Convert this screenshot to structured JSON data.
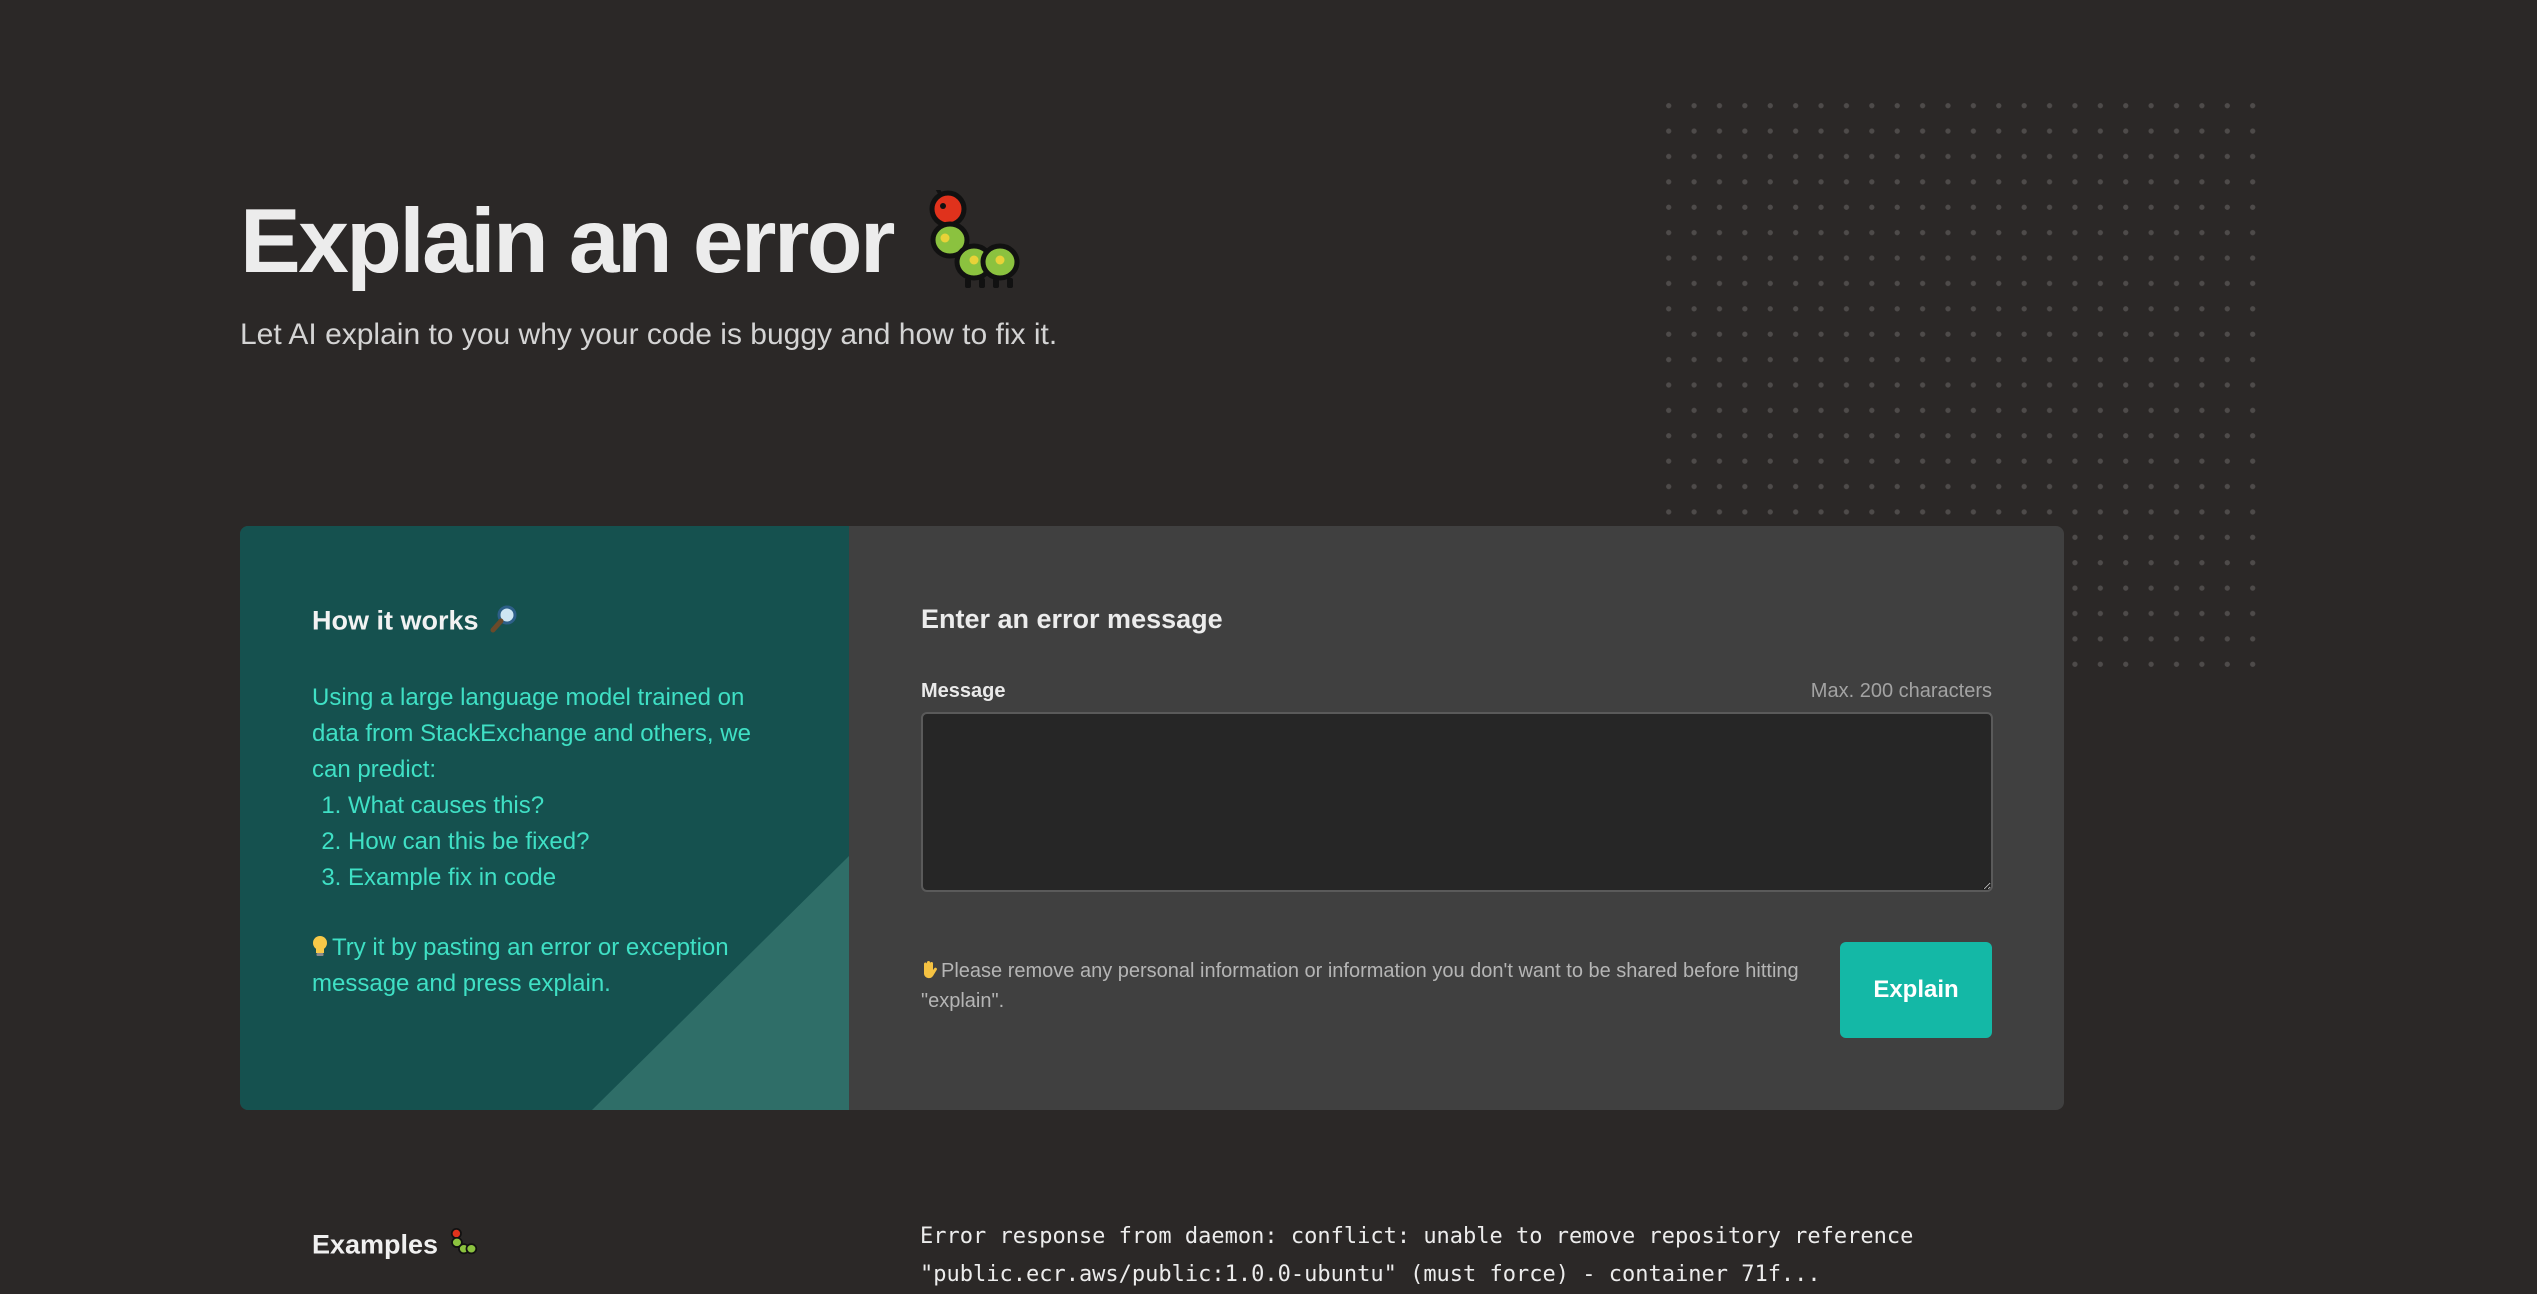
{
  "hero": {
    "title": "Explain an error",
    "title_icon": "caterpillar-icon",
    "subtitle": "Let AI explain to you why your code is buggy and how to fix it."
  },
  "how_it_works": {
    "title": "How it works",
    "title_icon": "magnifier-icon",
    "intro": "Using a large language model trained on data from StackExchange and others, we can predict:",
    "steps": [
      "What causes this?",
      "How can this be fixed?",
      "Example fix in code"
    ],
    "tip_icon": "light-bulb-icon",
    "tip": "Try it by pasting an error or exception message and press explain."
  },
  "form": {
    "title": "Enter an error message",
    "message_label": "Message",
    "message_max": "Max. 200 characters",
    "message_value": "",
    "notice_icon": "raised-hand-icon",
    "notice": "Please remove any personal information or information you don't want to be shared before hitting \"explain\".",
    "submit_label": "Explain"
  },
  "examples": {
    "title": "Examples",
    "title_icon": "caterpillar-icon",
    "first_example_line1": "Error response from daemon: conflict: unable to remove repository reference",
    "first_example_line2": "\"public.ecr.aws/public:1.0.0-ubuntu\" (must force) - container 71f..."
  },
  "colors": {
    "background": "#2b2827",
    "panel_teal": "#15514f",
    "accent_text": "#3fe0c5",
    "button": "#14b8a6",
    "card_right": "#404040"
  }
}
